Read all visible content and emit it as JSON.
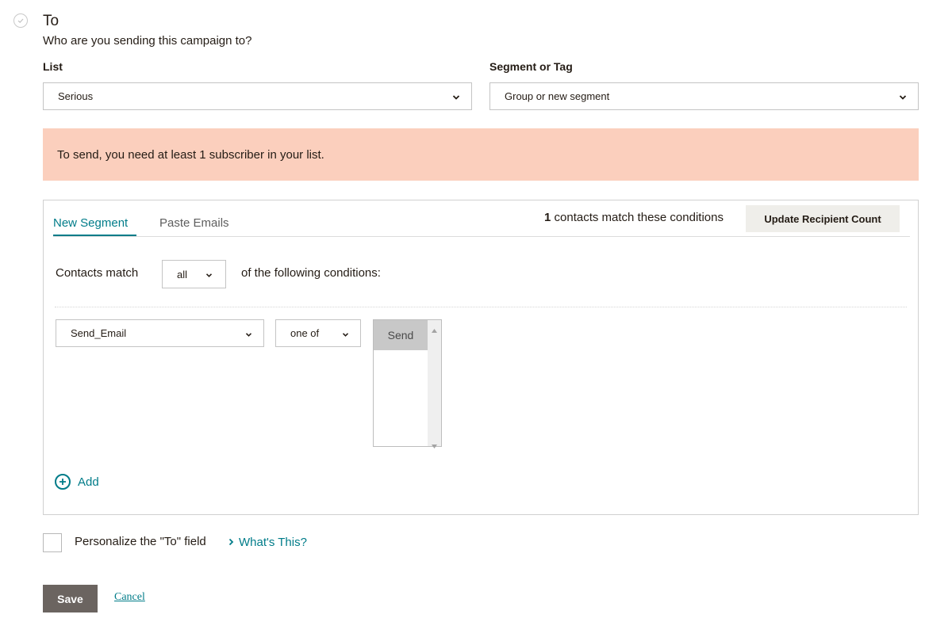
{
  "header": {
    "title": "To",
    "subtitle": "Who are you sending this campaign to?"
  },
  "list": {
    "label": "List",
    "value": "Serious"
  },
  "segment": {
    "label": "Segment or Tag",
    "value": "Group or new segment"
  },
  "warning": {
    "text": "To send, you need at least 1 subscriber in your list.",
    "color": "#fbcfbd"
  },
  "segment_panel": {
    "tabs": [
      {
        "label": "New Segment",
        "active": true
      },
      {
        "label": "Paste Emails",
        "active": false
      }
    ],
    "match_count": "1",
    "match_text": "contacts match these conditions",
    "update_button": "Update Recipient Count",
    "contacts_match_label": "Contacts match",
    "match_mode": "all",
    "conditions_suffix": "of the following conditions:",
    "condition": {
      "field": "Send_Email",
      "operator": "one of",
      "options": [
        "Send"
      ]
    },
    "add_label": "Add"
  },
  "personalize": {
    "label": "Personalize the \"To\" field",
    "help_link": "What's This?",
    "checked": false
  },
  "actions": {
    "save": "Save",
    "cancel": "Cancel"
  },
  "colors": {
    "accent": "#007c89",
    "save_button": "#6b6460"
  }
}
